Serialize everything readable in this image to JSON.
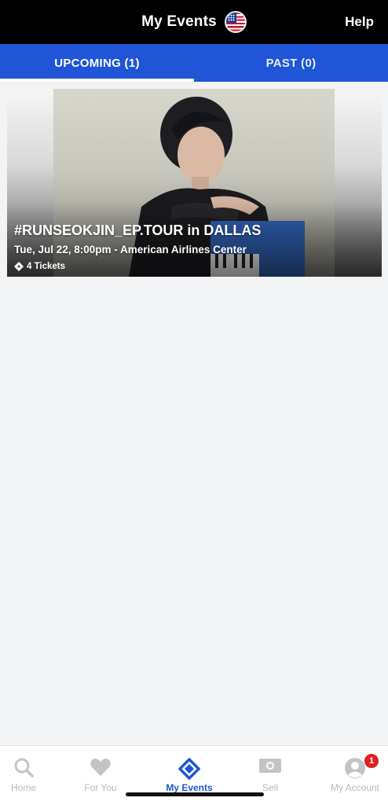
{
  "header": {
    "title": "My Events",
    "help_label": "Help",
    "region_flag": "us-flag-icon"
  },
  "tabs": [
    {
      "label": "UPCOMING (1)",
      "active": true
    },
    {
      "label": "PAST (0)",
      "active": false
    }
  ],
  "events": [
    {
      "name": "#RUNSEOKJIN_EP.TOUR in DALLAS",
      "date_time_venue": "Tue, Jul 22, 8:00pm - American Airlines Center",
      "tickets": "4 Tickets"
    }
  ],
  "bottom_nav": [
    {
      "label": "Home",
      "icon": "search-icon",
      "active": false
    },
    {
      "label": "For You",
      "icon": "heart-icon",
      "active": false
    },
    {
      "label": "My Events",
      "icon": "ticket-icon",
      "active": true
    },
    {
      "label": "Sell",
      "icon": "cash-icon",
      "active": false
    },
    {
      "label": "My Account",
      "icon": "account-icon",
      "active": false,
      "badge": "1"
    }
  ],
  "colors": {
    "brand_blue": "#1f55d6",
    "badge_red": "#e02020",
    "header_black": "#000000"
  }
}
